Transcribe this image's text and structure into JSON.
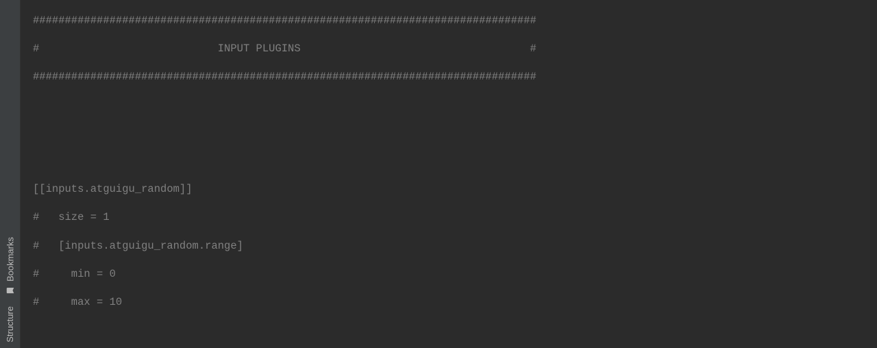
{
  "sidebar": {
    "tabs": [
      {
        "label": "Bookmarks",
        "icon": "🔖"
      },
      {
        "label": "Structure",
        "icon": ""
      }
    ]
  },
  "editor": {
    "hash_rule": "###############################################################################",
    "header_title": "#                            INPUT PLUGINS                                    #",
    "lines": {
      "table_decl": "[[inputs.atguigu_random]]",
      "size_comment": "#   size = 1",
      "range_comment": "#   [inputs.atguigu_random.range]",
      "min_comment": "#     min = 0",
      "max_comment": "#     max = 10"
    }
  }
}
